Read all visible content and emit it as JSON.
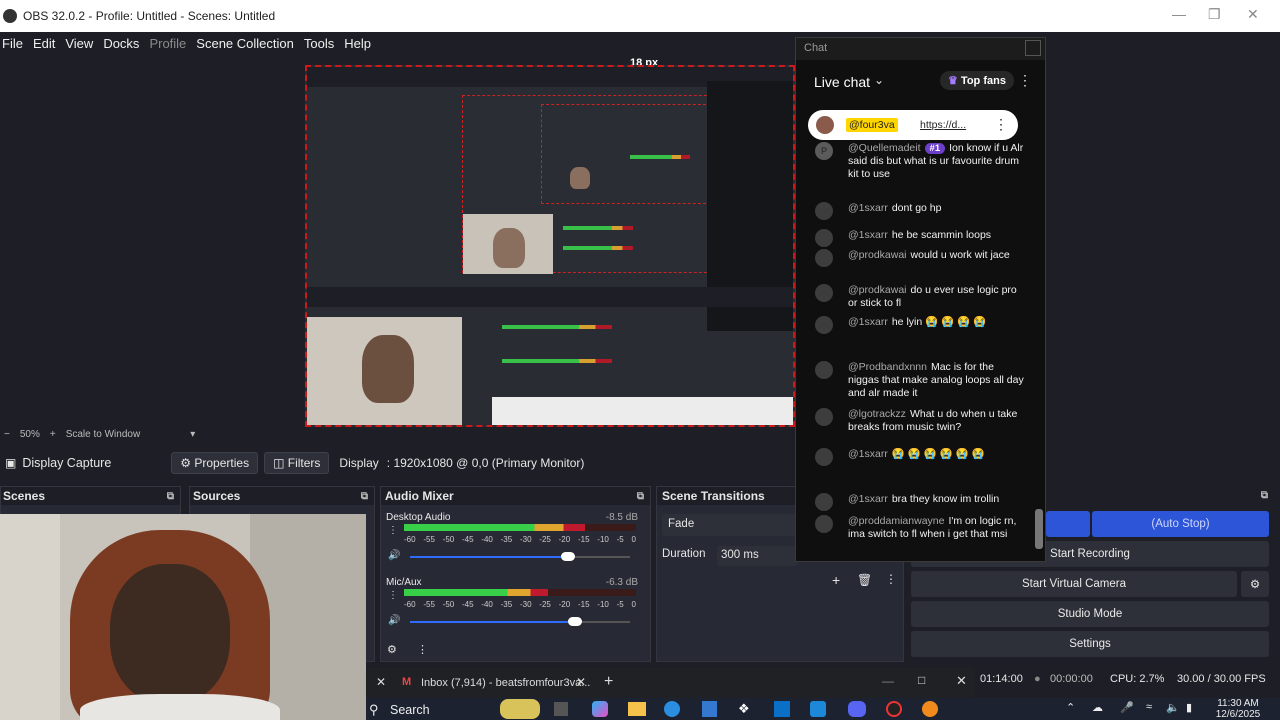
{
  "window": {
    "title": "OBS 32.0.2 - Profile: Untitled - Scenes: Untitled"
  },
  "menu": [
    "File",
    "Edit",
    "View",
    "Docks",
    "Profile",
    "Scene Collection",
    "Tools",
    "Help"
  ],
  "preview": {
    "px_label": "18 px"
  },
  "zoom": {
    "level": "50%",
    "mode": "Scale to Window"
  },
  "source_toolbar": {
    "source": "Display Capture",
    "properties": "Properties",
    "filters": "Filters",
    "display_label": "Display",
    "display_value": ": 1920x1080 @ 0,0 (Primary Monitor)"
  },
  "docks": {
    "scenes": "Scenes",
    "sources": "Sources",
    "audio_mixer": "Audio Mixer",
    "scene_transitions": "Scene Transitions"
  },
  "audio": {
    "channels": [
      {
        "name": "Desktop Audio",
        "db": "-8.5 dB",
        "level": 0.78,
        "volume": 0.72
      },
      {
        "name": "Mic/Aux",
        "db": "-6.3 dB",
        "level": 0.62,
        "volume": 0.75
      }
    ],
    "ticks": [
      "-60",
      "-55",
      "-50",
      "-45",
      "-40",
      "-35",
      "-30",
      "-25",
      "-20",
      "-15",
      "-10",
      "-5",
      "0"
    ]
  },
  "transitions": {
    "type": "Fade",
    "duration_label": "Duration",
    "duration_value": "300 ms"
  },
  "controls": {
    "auto_stop": "(Auto Stop)",
    "start_recording": "Start Recording",
    "start_virtual_camera": "Start Virtual Camera",
    "studio_mode": "Studio Mode",
    "settings": "Settings"
  },
  "status": {
    "stream_time": "01:14:00",
    "rec_time": "00:00:00",
    "cpu": "CPU: 2.7%",
    "fps": "30.00 / 30.00 FPS"
  },
  "chat": {
    "window_title": "Chat",
    "header": "Live chat",
    "top_fans": "Top fans",
    "pinned": {
      "user": "@four3va",
      "text": "https://d..."
    },
    "badge": "#1",
    "messages": [
      {
        "user": "@Quellemadeit",
        "text": "Ion know if u Alr said dis but what is ur favourite drum kit to use",
        "avatar": "P"
      },
      {
        "user": "@1sxarr",
        "text": "dont go hp",
        "avatar": ""
      },
      {
        "user": "@1sxarr",
        "text": "he be scammin loops",
        "avatar": ""
      },
      {
        "user": "@prodkawai",
        "text": "would u work wit jace",
        "avatar": ""
      },
      {
        "user": "@prodkawai",
        "text": "do u ever use logic pro or stick to fl",
        "avatar": ""
      },
      {
        "user": "@1sxarr",
        "text": "he lyin 😭 😭 😭 😭",
        "avatar": ""
      },
      {
        "user": "@Prodbandxnnn",
        "text": "Mac is for the niggas that make analog loops all day and alr made it",
        "avatar": ""
      },
      {
        "user": "@lgotrackzz",
        "text": "What u do when u take breaks from music twin?",
        "avatar": ""
      },
      {
        "user": "@1sxarr",
        "text": "😭 😭 😭 😭 😭 😭",
        "avatar": ""
      },
      {
        "user": "@1sxarr",
        "text": "bra they know im trollin",
        "avatar": ""
      },
      {
        "user": "@proddamianwayne",
        "text": "I'm on logic rn, ima switch to fl when i get that msi",
        "avatar": ""
      }
    ]
  },
  "browser_tab": {
    "title": "Inbox (7,914) - beatsfromfour3va..."
  },
  "taskbar": {
    "search": "Search",
    "time": "11:30 AM",
    "date": "12/6/2025"
  }
}
